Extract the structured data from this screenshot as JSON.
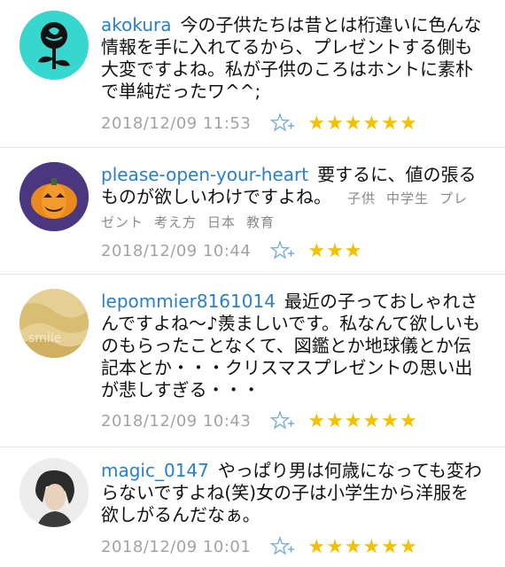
{
  "comments": [
    {
      "user": "akokura",
      "text": "今の子供たちは昔とは桁違いに色んな情報を手に入れてるから、プレゼントする側も大変ですよね。私が子供のころはホントに素朴で単純だったワ^^;",
      "tags": [],
      "time": "2018/12/09 11:53",
      "stars": "★★★★★★",
      "star_count": 6
    },
    {
      "user": "please-open-your-heart",
      "text": "要するに、値の張るものが欲しいわけですよね。",
      "tags": [
        "子供",
        "中学生",
        "プレゼント",
        "考え方",
        "日本",
        "教育"
      ],
      "time": "2018/12/09 10:44",
      "stars": "★★★",
      "star_count": 3
    },
    {
      "user": "lepommier8161014",
      "text": "最近の子っておしゃれさんですよね〜♪羨ましいです。私なんて欲しいものもらったことなくて、図鑑とか地球儀とか伝記本とか・・・クリスマスプレゼントの思い出が悲しすぎる・・・",
      "tags": [],
      "time": "2018/12/09 10:43",
      "stars": "★★★★★★",
      "star_count": 6
    },
    {
      "user": "magic_0147",
      "text": "やっぱり男は何歳になっても変わらないですよね(笑)女の子は小学生から洋服を欲しがるんだなぁ。",
      "tags": [],
      "time": "2018/12/09 10:01",
      "stars": "★★★★★★",
      "star_count": 6
    }
  ],
  "colors": {
    "username": "#2a7fc7",
    "star": "#f2c100",
    "star_add": "#7aaed9",
    "timestamp": "#a3a3a3",
    "tags": "#8a8a8a"
  }
}
